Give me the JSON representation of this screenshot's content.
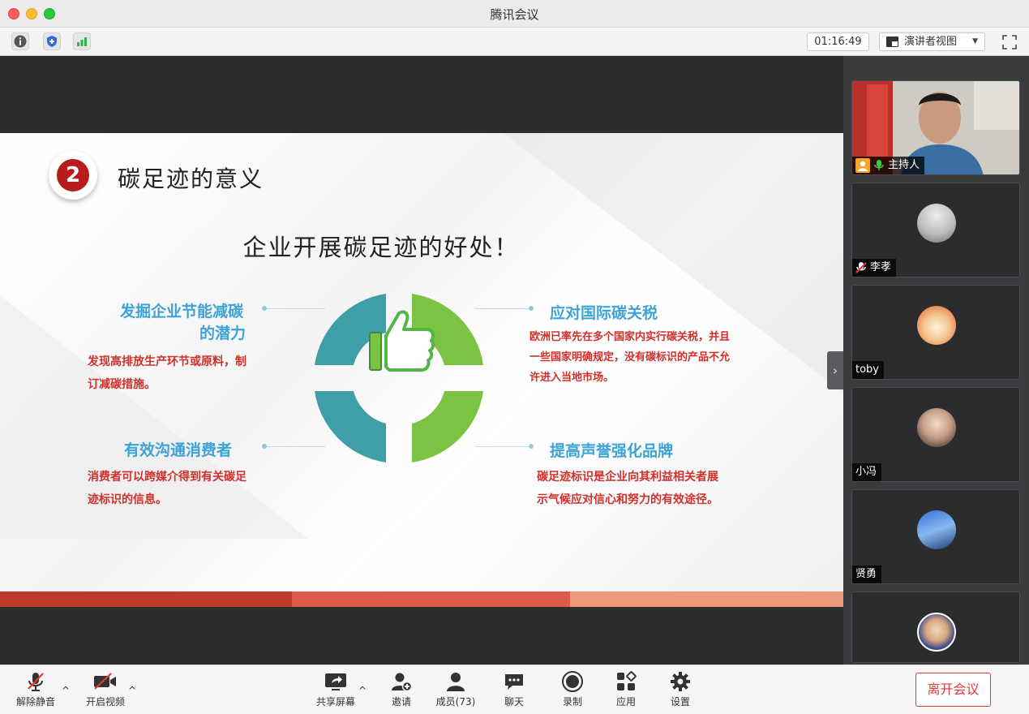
{
  "window": {
    "title": "腾讯会议"
  },
  "toolbar": {
    "timer": "01:16:49",
    "view_mode": "演讲者视图"
  },
  "slide": {
    "number": "2",
    "title": "碳足迹的意义",
    "subtitle": "企业开展碳足迹的好处！",
    "points": [
      {
        "heading_line1": "发掘企业节能减碳",
        "heading_line2": "的潜力",
        "body_line1": "发现高排放生产环节或原料，制",
        "body_line2": "订减碳措施。"
      },
      {
        "heading": "应对国际碳关税",
        "body_line1": "欧洲已率先在多个国家内实行碳关税，并且",
        "body_line2": "一些国家明确规定，没有碳标识的产品不允",
        "body_line3": "许进入当地市场。"
      },
      {
        "heading": "有效沟通消费者",
        "body_line1": "消费者可以跨媒介得到有关碳足",
        "body_line2": "迹标识的信息。"
      },
      {
        "heading": "提高声誉强化品牌",
        "body_line1": "碳足迹标识是企业向其利益相关者展",
        "body_line2": "示气候应对信心和努力的有效途径。"
      }
    ],
    "colors": {
      "teal": "#3f9fa9",
      "green": "#7cc243",
      "red_stripe": "#c0392b",
      "heading_blue": "#3da3d6",
      "body_red": "#d0302c"
    }
  },
  "participants": [
    {
      "name": "主持人",
      "role": "host"
    },
    {
      "name": "李孝"
    },
    {
      "name": "toby"
    },
    {
      "name": "小冯"
    },
    {
      "name": "贤勇"
    },
    {
      "name": ""
    }
  ],
  "controls": {
    "unmute": "解除静音",
    "start_video": "开启视频",
    "share_screen": "共享屏幕",
    "invite": "邀请",
    "members": "成员(73)",
    "chat": "聊天",
    "record": "录制",
    "apps": "应用",
    "settings": "设置",
    "leave": "离开会议"
  }
}
